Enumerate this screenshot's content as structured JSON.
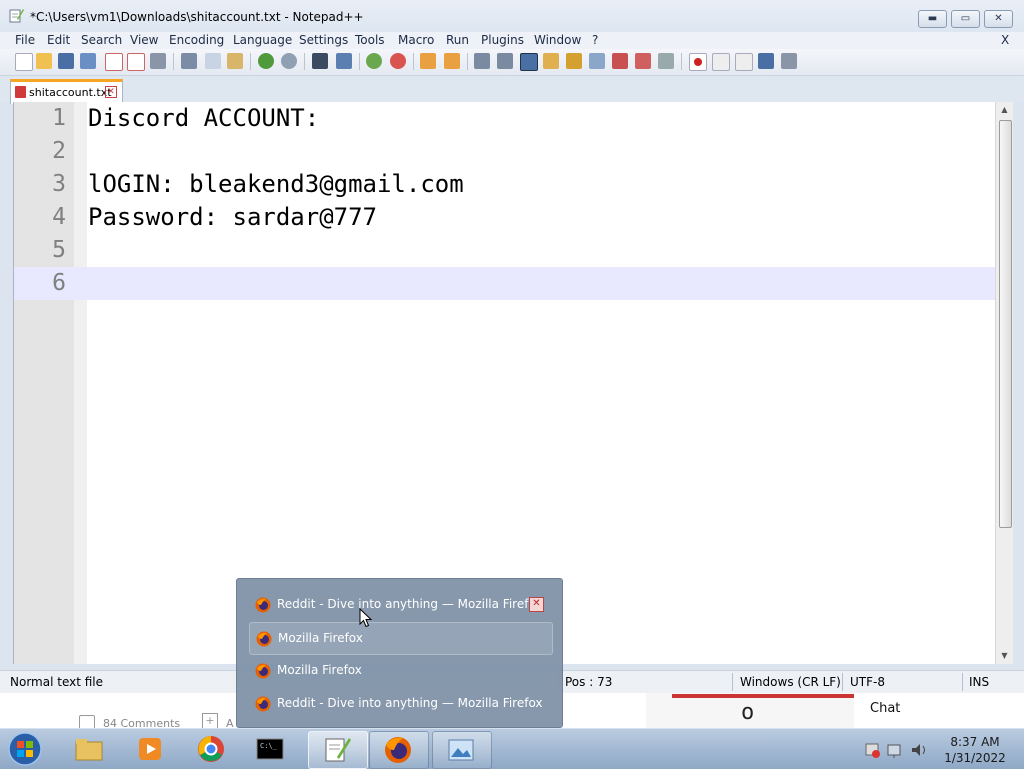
{
  "window": {
    "title": "*C:\\Users\\vm1\\Downloads\\shitaccount.txt - Notepad++",
    "buttons": {
      "minimize": "▬",
      "maximize": "▭",
      "close": "✕"
    }
  },
  "menu": {
    "items": [
      "File",
      "Edit",
      "Search",
      "View",
      "Encoding",
      "Language",
      "Settings",
      "Tools",
      "Macro",
      "Run",
      "Plugins",
      "Window",
      "?"
    ],
    "close_label": "X"
  },
  "tab": {
    "label": "shitaccount.txt",
    "close": "✕"
  },
  "editor": {
    "lines": [
      {
        "number": "1",
        "text": "Discord ACCOUNT:"
      },
      {
        "number": "2",
        "text": ""
      },
      {
        "number": "3",
        "text": "lOGIN: bleakend3@gmail.com"
      },
      {
        "number": "4",
        "text": "Password: sardar@777"
      },
      {
        "number": "5",
        "text": ""
      },
      {
        "number": "6",
        "text": ""
      }
    ],
    "current_line": 6
  },
  "statusbar": {
    "file_type": "Normal text file",
    "position": "Pos : 73",
    "eol": "Windows (CR LF)",
    "encoding": "UTF-8",
    "mode": "INS"
  },
  "background_page": {
    "comments": "84 Comments",
    "add_label": "A",
    "chat_label": "Chat",
    "char": "o"
  },
  "firefox_jumplist": {
    "items": [
      {
        "label": "Reddit - Dive into anything — Mozilla Firefox",
        "closable": true
      },
      {
        "label": "Mozilla Firefox"
      },
      {
        "label": "Mozilla Firefox"
      },
      {
        "label": "Reddit - Dive into anything — Mozilla Firefox"
      }
    ]
  },
  "taskbar": {
    "items": [
      "start-orb",
      "windows-explorer",
      "media-player",
      "google-chrome",
      "command-prompt",
      "notepad-plus-plus",
      "firefox",
      "photo-viewer"
    ],
    "clock_time": "8:37 AM",
    "clock_date": "1/31/2022"
  },
  "colors": {
    "current_line": "#e8e8ff",
    "tab_accent": "#f6a623",
    "popup_bg": "#8192a8"
  }
}
